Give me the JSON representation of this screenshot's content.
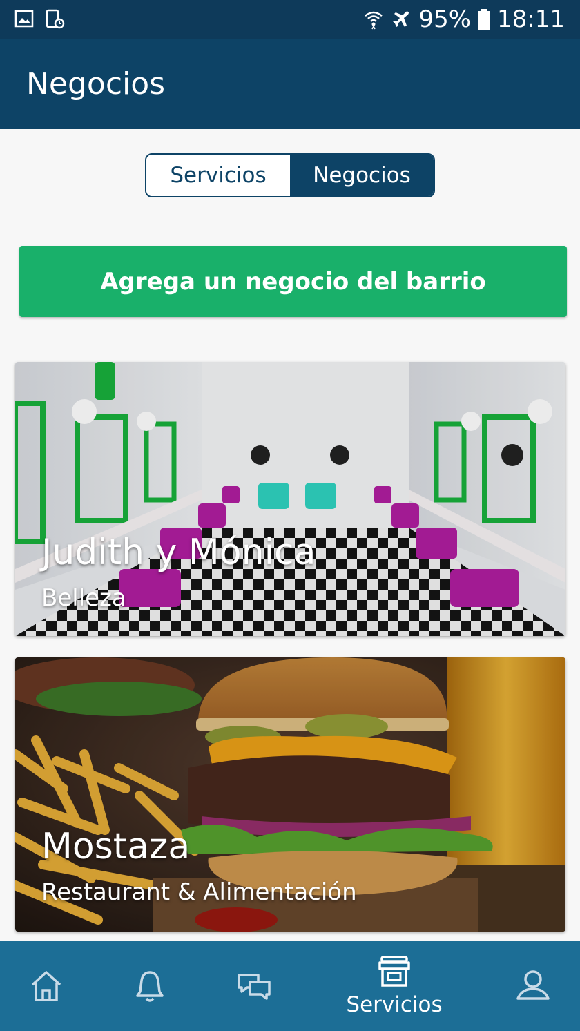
{
  "status_bar": {
    "battery": "95%",
    "time": "18:11",
    "icons": [
      "image-icon",
      "screenshot-icon",
      "wifi-icon",
      "airplane-icon",
      "battery-icon"
    ]
  },
  "app_bar": {
    "title": "Negocios"
  },
  "segmented": {
    "tab_services": "Servicios",
    "tab_businesses": "Negocios",
    "selected": "Negocios"
  },
  "add_button": {
    "label": "Agrega un negocio del barrio"
  },
  "businesses": [
    {
      "name": "Judith y Mónica",
      "category": "Belleza"
    },
    {
      "name": "Mostaza",
      "category": "Restaurant & Alimentación"
    }
  ],
  "bottom_nav": {
    "items": [
      {
        "icon": "home-icon"
      },
      {
        "icon": "bell-icon"
      },
      {
        "icon": "chat-icon"
      },
      {
        "icon": "store-icon",
        "label": "Servicios",
        "active": true
      },
      {
        "icon": "profile-icon"
      }
    ]
  },
  "colors": {
    "status_bar": "#0e3a5a",
    "app_bar": "#0d4366",
    "accent_green": "#19b06a",
    "bottom_nav": "#1c6e96"
  }
}
